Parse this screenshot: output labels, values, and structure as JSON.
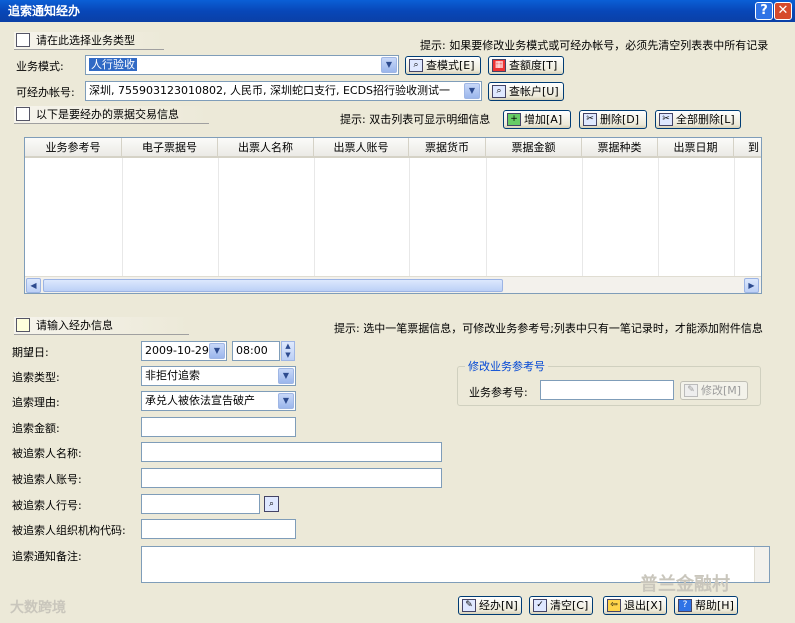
{
  "window": {
    "title": "追索通知经办"
  },
  "biz": {
    "header": "请在此选择业务类型",
    "hint": "提示: 如果要修改业务模式或可经办帐号，必须先清空列表表中所有记录",
    "mode_label": "业务模式:",
    "mode_value": "人行验收",
    "account_label": "可经办帐号:",
    "account_value": "深圳, 755903123010802, 人民币, 深圳蛇口支行, ECDS招行验收测试一",
    "btn_query_mode": "查模式[E]",
    "btn_query_quota": "查额度[T]",
    "btn_query_account": "查帐户[U]"
  },
  "bills": {
    "header": "以下是要经办的票据交易信息",
    "hint": "提示: 双击列表可显示明细信息",
    "btn_add": "增加[A]",
    "btn_delete": "删除[D]",
    "btn_delete_all": "全部删除[L]",
    "columns": [
      "业务参考号",
      "电子票据号",
      "出票人名称",
      "出票人账号",
      "票据货币",
      "票据金额",
      "票据种类",
      "出票日期",
      "到"
    ]
  },
  "form": {
    "header": "请输入经办信息",
    "hint": "提示: 选中一笔票据信息，可修改业务参考号;列表中只有一笔记录时，才能添加附件信息",
    "due_date_label": "期望日:",
    "due_date": "2009-10-29",
    "due_time": "08:00",
    "type_label": "追索类型:",
    "type_value": "非拒付追索",
    "reason_label": "追索理由:",
    "reason_value": "承兑人被依法宣告破产",
    "amount_label": "追索金额:",
    "payee_name_label": "被追索人名称:",
    "payee_account_label": "被追索人账号:",
    "payee_bank_label": "被追索人行号:",
    "payee_org_label": "被追索人组织机构代码:",
    "remark_label": "追索通知备注:"
  },
  "modify_ref": {
    "title": "修改业务参考号",
    "label": "业务参考号:",
    "btn_modify": "修改[M]"
  },
  "footer": {
    "btn_submit": "经办[N]",
    "btn_clear": "清空[C]",
    "btn_exit": "退出[X]",
    "btn_help": "帮助[H]"
  },
  "watermarks": {
    "left": "大数跨境",
    "right": "普兰金融村"
  }
}
